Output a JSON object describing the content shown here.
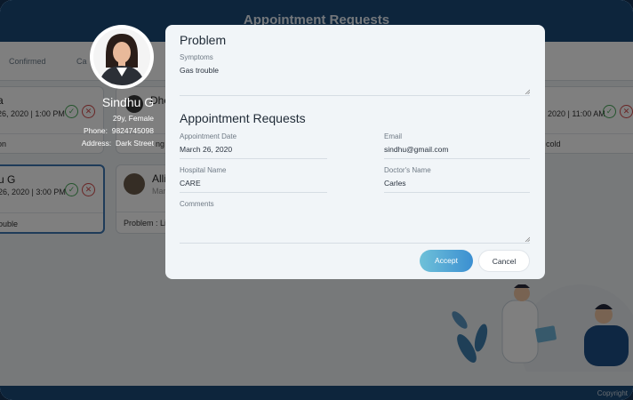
{
  "app": {
    "title": "Appointment Requests",
    "tabs": [
      "Confirmed",
      "Ca"
    ],
    "copyright": "Copyright"
  },
  "background_cards": [
    {
      "name": "a",
      "date": "26, 2020 | 1:00 PM",
      "problem": "on"
    },
    {
      "name": "u G",
      "date": "26, 2020 | 3:00 PM",
      "problem": "ouble"
    },
    {
      "name": "Dhe",
      "date": "",
      "problem": "ng"
    },
    {
      "name": "Alli",
      "date": "Marc",
      "problem": "Problem : Liv"
    },
    {
      "name": "",
      "date": "2020 | 11:00 AM",
      "problem": "cold"
    }
  ],
  "patient": {
    "name": "Sindhu G",
    "age_gender": "29y, Female",
    "phone_label": "Phone:",
    "phone": "9824745098",
    "address_label": "Address:",
    "address": "Dark Street"
  },
  "modal": {
    "problem_heading": "Problem",
    "symptoms_label": "Symptoms",
    "symptoms_value": "Gas trouble",
    "section_heading": "Appointment Requests",
    "appointment_date_label": "Appointment Date",
    "appointment_date_value": "March 26, 2020",
    "email_label": "Email",
    "email_value": "sindhu@gmail.com",
    "hospital_label": "Hospital Name",
    "hospital_value": "CARE",
    "doctor_label": "Doctor's Name",
    "doctor_value": "Carles",
    "comments_label": "Comments",
    "comments_value": "",
    "accept_label": "Accept",
    "cancel_label": "Cancel"
  },
  "colors": {
    "header": "#1b4a78",
    "accept_gradient_start": "#6fc1d9",
    "accept_gradient_end": "#3b8fd1",
    "modal_bg": "#f1f5f8"
  }
}
